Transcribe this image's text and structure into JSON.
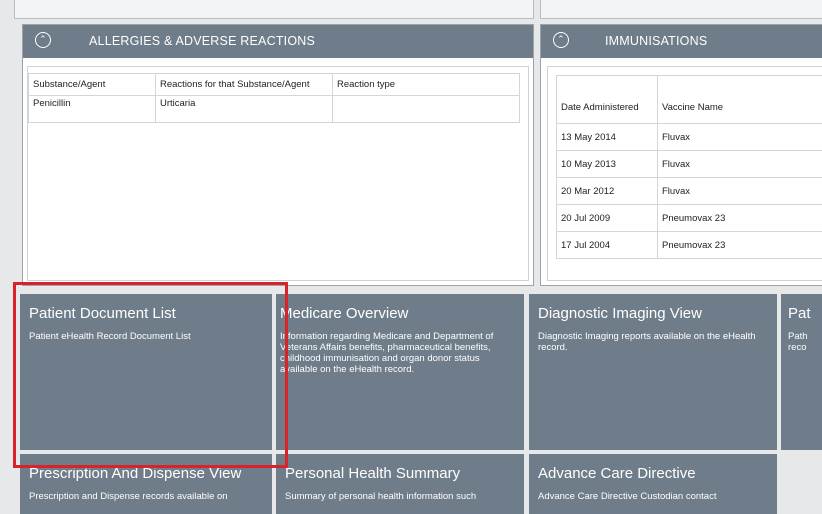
{
  "allergies": {
    "title": "ALLERGIES & ADVERSE REACTIONS",
    "columns": [
      "Substance/Agent",
      "Reactions for that Substance/Agent",
      "Reaction type"
    ],
    "rows": [
      [
        "Penicillin",
        "Urticaria",
        ""
      ]
    ]
  },
  "immunisations": {
    "title": "IMMUNISATIONS",
    "columns": [
      "Date Administered",
      "Vaccine Name"
    ],
    "rows": [
      [
        "13 May 2014",
        "Fluvax"
      ],
      [
        "10 May 2013",
        "Fluvax"
      ],
      [
        "20 Mar 2012",
        "Fluvax"
      ],
      [
        "20 Jul 2009",
        "Pneumovax 23"
      ],
      [
        "17 Jul 2004",
        "Pneumovax 23"
      ]
    ]
  },
  "tiles": [
    {
      "title": "Patient Document List",
      "desc": "Patient eHealth Record Document List"
    },
    {
      "title": "Medicare Overview",
      "desc": "Information regarding Medicare and Department of Veterans Affairs benefits, pharmaceutical benefits, childhood immunisation and organ donor status available on the eHealth record."
    },
    {
      "title": "Diagnostic Imaging View",
      "desc": "Diagnostic Imaging reports available on the eHealth record."
    },
    {
      "title": "Pat",
      "desc": "Path reco"
    },
    {
      "title": "Prescription And Dispense View",
      "desc": "Prescription and Dispense records available on"
    },
    {
      "title": "Personal Health Summary",
      "desc": "Summary of personal health information such"
    },
    {
      "title": "Advance Care Directive",
      "desc": "Advance Care Directive Custodian contact"
    }
  ],
  "colors": {
    "tile": "#6f7c8a",
    "highlight": "#d8232a"
  }
}
